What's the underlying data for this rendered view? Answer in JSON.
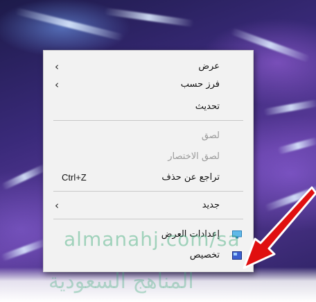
{
  "context_menu": {
    "items": [
      {
        "label": "عرض",
        "submenu": true,
        "enabled": true
      },
      {
        "label": "فرز حسب",
        "submenu": true,
        "enabled": true
      },
      {
        "label": "تحديث",
        "submenu": false,
        "enabled": true
      },
      {
        "label": "لصق",
        "submenu": false,
        "enabled": false
      },
      {
        "label": "لصق الاختصار",
        "submenu": false,
        "enabled": false
      },
      {
        "label": "تراجع عن حذف",
        "shortcut": "Ctrl+Z",
        "enabled": true
      },
      {
        "label": "جديد",
        "submenu": true,
        "enabled": true
      },
      {
        "label": "إعدادات العرض",
        "icon": "display-settings-icon",
        "enabled": true
      },
      {
        "label": "تخصيص",
        "icon": "personalize-icon",
        "enabled": true
      }
    ]
  },
  "watermark": {
    "text": "almanahj.com/sa",
    "arabic_text": "المناهج السعودية"
  },
  "colors": {
    "arrow": "#e01010",
    "menu_bg": "#f2f2f2"
  }
}
